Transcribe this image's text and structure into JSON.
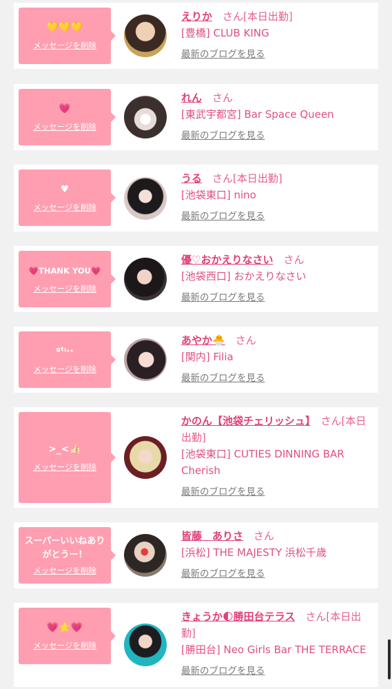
{
  "delete_label": "メッセージを削除",
  "blog_label": "最新のブログを見る",
  "colors": {
    "bubble": "#ff9eb1",
    "accent": "#e0407a",
    "background": "#f1f1f1"
  },
  "entries": [
    {
      "message": "💛💛💛",
      "name": "えりか",
      "suffix": "さん[本日出勤]",
      "shop": "[豊橋] CLUB KING"
    },
    {
      "message": "💗",
      "name": "れん",
      "suffix": "さん",
      "shop": "[東武宇都宮] Bar Space Queen"
    },
    {
      "message": "♥",
      "name": "うる",
      "suffix": "さん[本日出勤]",
      "shop": "[池袋東口] nino"
    },
    {
      "message": "💗THANK YOU💗",
      "name": "優♡おかえりなさい",
      "suffix": "さん",
      "shop": "[池袋西口] おかえりなさい"
    },
    {
      "message": "ᵍᵗᵎ··",
      "name": "あやか🐣",
      "suffix": "さん",
      "shop": "[関内] Filia"
    },
    {
      "message": ">_<👍🏻",
      "name": "かのん【池袋チェリッシュ】",
      "suffix": "さん[本日出勤]",
      "shop": "[池袋東口] CUTIES DINNING BAR Cherish"
    },
    {
      "message": "スーパーいいねありがとうー！",
      "name": "皆藤　ありさ",
      "suffix": "さん",
      "shop": "[浜松] THE MAJESTY 浜松千歳"
    },
    {
      "message": "💗⭐💗",
      "name": "きょうか🌓勝田台テラス",
      "suffix": "さん[本日出勤]",
      "shop": "[勝田台] Neo Girls Bar THE TERRACE"
    }
  ]
}
